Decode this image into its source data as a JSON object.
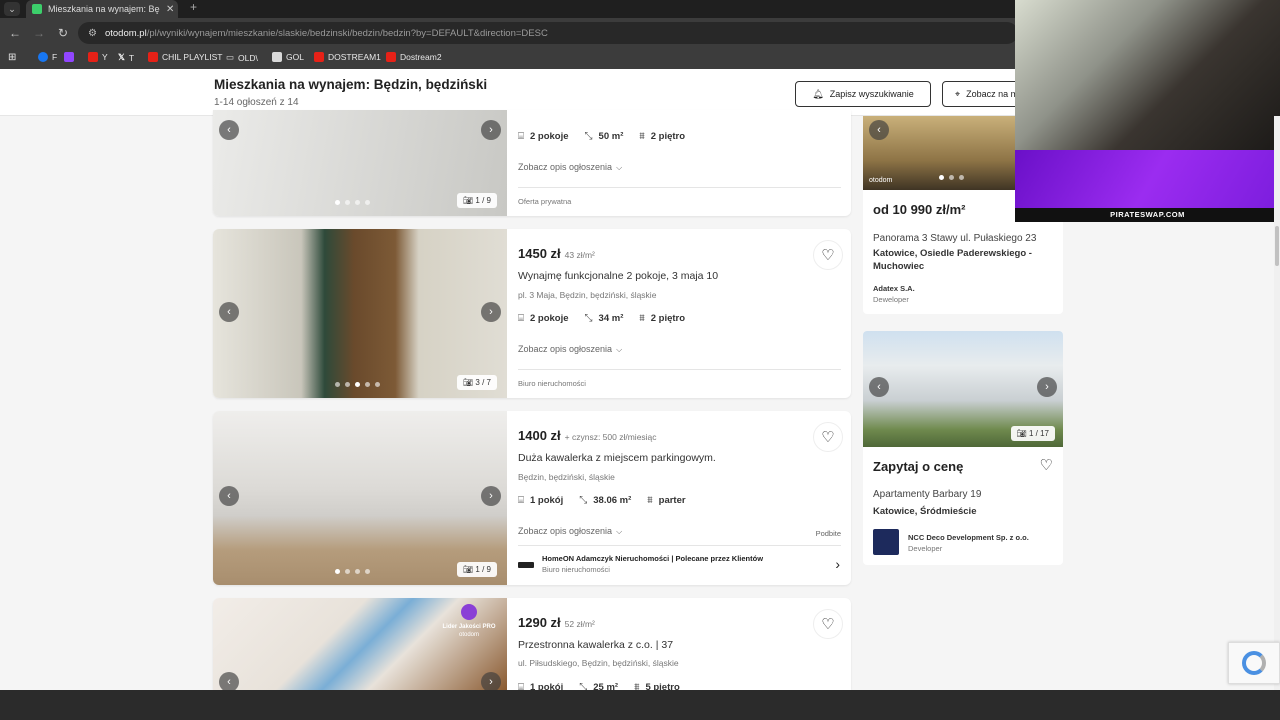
{
  "browser": {
    "tab_title": "Mieszkania na wynajem: Będzin",
    "url_domain": "otodom.pl",
    "url_path": "/pl/wyniki/wynajem/mieszkanie/slaskie/bedzinski/bedzin/bedzin?by=DEFAULT&direction=DESC",
    "bookmarks": [
      "F",
      "Y",
      "T",
      "CHIL PLAYLIST",
      "OLD\\",
      "GOL",
      "DOSTREAM1",
      "Dostream2"
    ]
  },
  "header": {
    "title": "Mieszkania na wynajem: Będzin, będziński",
    "subtitle": "1-14 ogłoszeń z 14",
    "save_label": "Zapisz wyszukiwanie",
    "view_label": "Zobacz na mapie"
  },
  "listings": [
    {
      "features": {
        "rooms": "2 pokoje",
        "area": "50 m²",
        "floor": "2 piętro"
      },
      "desc_label": "Zobacz opis ogłoszenia",
      "seller": "Oferta prywatna",
      "photo_count": "1 / 9",
      "colors": [
        "#e8e8e6",
        "#cfcfcc"
      ]
    },
    {
      "price": "1450 zł",
      "price_extra": "43 zł/m²",
      "title": "Wynajmę funkcjonalne 2 pokoje, 3 maja 10",
      "address": "pl. 3 Maja, Będzin, będziński, śląskie",
      "features": {
        "rooms": "2 pokoje",
        "area": "34 m²",
        "floor": "2 piętro"
      },
      "desc_label": "Zobacz opis ogłoszenia",
      "seller": "Biuro nieruchomości",
      "photo_count": "3 / 7",
      "colors": [
        "#d5d3ca",
        "#5a4530"
      ]
    },
    {
      "price": "1400 zł",
      "price_extra": "+ czynsz: 500 zł/miesiąc",
      "title": "Duża kawalerka z miejscem parkingowym.",
      "address": "Będzin, będziński, śląskie",
      "features": {
        "rooms": "1 pokój",
        "area": "38.06 m²",
        "floor": "parter"
      },
      "desc_label": "Zobacz opis ogłoszenia",
      "promo": "Podbite",
      "agency": "HomeON Adamczyk Nieruchomości | Polecane przez Klientów",
      "agency_type": "Biuro nieruchomości",
      "photo_count": "1 / 9",
      "colors": [
        "#e4e2e0",
        "#b9a58c"
      ]
    },
    {
      "price": "1290 zł",
      "price_extra": "52 zł/m²",
      "title": "Przestronna kawalerka z c.o. | 37",
      "address": "ul. Piłsudskiego, Będzin, będziński, śląskie",
      "features": {
        "rooms": "1 pokój",
        "area": "25 m²",
        "floor": "5 piętro"
      },
      "badge_line1": "Lider Jakości PRO",
      "badge_line2": "otodom",
      "colors": [
        "#efe9e2",
        "#8a5a30"
      ]
    }
  ],
  "sidebar": [
    {
      "price": "od 10 990 zł/m²",
      "name": "Panorama 3 Stawy ul. Pułaskiego 23",
      "location": "Katowice, Osiedle Paderewskiego - Muchowiec",
      "developer": "Adatex S.A.",
      "developer_label": "Deweloper",
      "watermark": "otodom"
    },
    {
      "price": "Zapytaj o cenę",
      "name": "Apartamenty Barbary 19",
      "location": "Katowice, Śródmieście",
      "developer": "NCC Deco Development Sp. z o.o.",
      "developer_label": "Developer",
      "photo_count": "1 / 17"
    }
  ],
  "stream": {
    "banner": "PIRATESWAP.COM"
  },
  "icons": {
    "heart": "heart-icon",
    "camera": "camera-icon",
    "bell": "bell-icon",
    "chevron": "chevron-down-icon"
  }
}
